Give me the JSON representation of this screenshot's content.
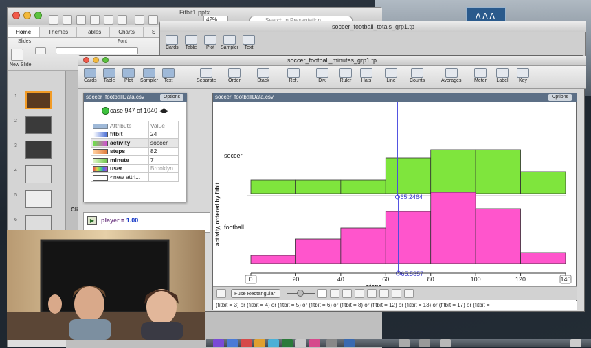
{
  "desktop": {
    "logo_text": "ᐱᐱᐱ"
  },
  "powerpoint": {
    "title": "Fitbit1.pptx",
    "zoom": "42%",
    "search_placeholder": "Search in Presentation",
    "tabs": [
      "Home",
      "Themes",
      "Tables",
      "Charts",
      "S"
    ],
    "ribbon_groups": {
      "slides": "Slides",
      "font": "Font"
    },
    "new_slide_label": "New Slide",
    "slide_numbers": [
      "1",
      "2",
      "3",
      "4",
      "5",
      "6"
    ],
    "click_hint": "Clic"
  },
  "totals_window": {
    "title": "soccer_football_totals_grp1.tp",
    "toolbar": [
      "Cards",
      "Table",
      "Plot",
      "Sampler",
      "Text"
    ]
  },
  "main_window": {
    "title": "soccer_football_minutes_grp1.tp",
    "toolbar_left": [
      "Cards",
      "Table",
      "Plot",
      "Sampler",
      "Text"
    ],
    "toolbar_right": [
      "Separate",
      "Order",
      "Stack",
      "Ref.",
      "Div.",
      "Ruler",
      "Hats",
      "Line",
      "Counts",
      "Averages",
      "Meter",
      "Label",
      "Key"
    ]
  },
  "case_table": {
    "title": "soccer_footballData.csv",
    "options_label": "Options",
    "case_text": "case 947 of 1040",
    "nav_arrows": "◀▶",
    "header_attribute": "Attribute",
    "header_value": "Value",
    "rows": [
      {
        "name": "fitbit",
        "value": "24"
      },
      {
        "name": "activity",
        "value": "soccer"
      },
      {
        "name": "steps",
        "value": "82"
      },
      {
        "name": "minute",
        "value": "7"
      },
      {
        "name": "user",
        "value": "Brooklyn"
      },
      {
        "name": "<new attri...",
        "value": ""
      }
    ],
    "colors": {
      "fitbit": "#4a6fd6",
      "activity": "#d64ad6",
      "steps": "#e07a3a",
      "minute": "#6ec84a",
      "user": "#c84a8c"
    }
  },
  "player": {
    "label": "player = ",
    "value": "1.00",
    "play_glyph": "▶"
  },
  "graph": {
    "title": "soccer_footballData.csv",
    "options_label": "Options",
    "fuse_label": "Fuse Rectangular",
    "formula": "(fitbit = 3) or (fitbit = 4) or (fitbit = 5) or (fitbit = 6) or (fitbit = 8) or (fitbit = 12) or (fitbit = 13) or (fitbit = 17) or (fitbit ="
  },
  "chart_data": {
    "type": "histogram",
    "xlabel": "steps",
    "ylabel": "activity, ordered by fitbit",
    "xlim": [
      0,
      140
    ],
    "x_ticks": [
      0,
      20,
      40,
      60,
      80,
      100,
      120,
      140
    ],
    "bin_edges": [
      0,
      20,
      40,
      60,
      80,
      100,
      120
    ],
    "groups": [
      {
        "name": "soccer",
        "color": "#7fe53d",
        "bin_heights": [
          0.5,
          0.5,
          0.5,
          1.3,
          1.6,
          1.6,
          0.8
        ]
      },
      {
        "name": "football",
        "color": "#ff55cc",
        "bin_heights": [
          0.3,
          0.9,
          1.3,
          1.9,
          2.6,
          2.0,
          0.4
        ]
      }
    ],
    "mean_lines": [
      {
        "group": "soccer",
        "value": 65.2464,
        "label": "65.2464"
      },
      {
        "group": "football",
        "value": 65.5857,
        "label": "65.5857"
      }
    ]
  }
}
